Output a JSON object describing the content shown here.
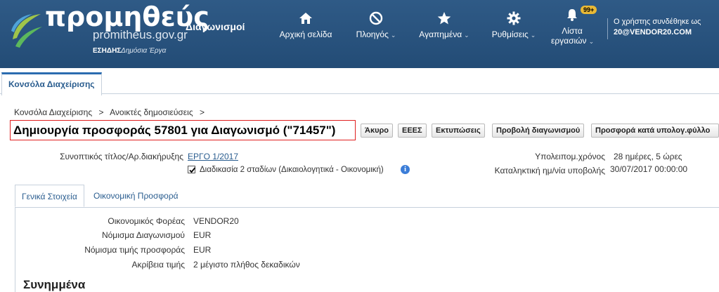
{
  "header": {
    "logo_word": "προμηθεύς",
    "logo_domain": "promitheus.gov.gr",
    "logo_org": "ΕΣΗΔΗΣ",
    "logo_sub": "Δημόσια Έργα",
    "app_name": "Διαγωνισμοί",
    "nav": [
      {
        "label": "Αρχική σελίδα",
        "icon": "home-icon"
      },
      {
        "label": "Πλοηγός",
        "icon": "no-entry-icon"
      },
      {
        "label": "Αγαπημένα",
        "icon": "star-icon"
      },
      {
        "label": "Ρυθμίσεις",
        "icon": "gear-icon"
      },
      {
        "label_line1": "Λίστα",
        "label_line2": "εργασιών",
        "icon": "bell-icon",
        "badge": "99+"
      }
    ],
    "user_prefix": "Ο χρήστης συνδέθηκε ως",
    "user_name": "20@VENDOR20.COM"
  },
  "console_tab": "Κονσόλα Διαχείρισης",
  "breadcrumb": {
    "items": [
      "Κονσόλα Διαχείρισης",
      "Ανοικτές δημοσιεύσεις"
    ],
    "separator": ">"
  },
  "page_title": "Δημιουργία προσφοράς 57801 για Διαγωνισμό (\"71457\")",
  "buttons": {
    "cancel": "Άκυρο",
    "eeeS": "ΕΕΕΣ",
    "prints": "Εκτυπώσεις",
    "view_tender": "Προβολή διαγωνισμού",
    "offer_by_sheet": "Προσφορά κατά υπολογ.φύλλο"
  },
  "summary": {
    "title_label": "Συνοπτικός τίτλος/Αρ.διακήρυξης",
    "title_value": "ΕΡΓΟ 1/2017",
    "two_stage_label": "Διαδικασία 2 σταδίων (Δικαιολογητικά - Οικονομική)",
    "two_stage_checked": true,
    "remaining_label": "Υπολειπομ.χρόνος",
    "remaining_value": "28 ημέρες, 5 ώρες",
    "deadline_label": "Καταληκτική ημ/νία υποβολής",
    "deadline_value": "30/07/2017 00:00:00"
  },
  "subtabs": [
    "Γενικά Στοιχεία",
    "Οικονομική Προσφορά"
  ],
  "general": {
    "rows": [
      {
        "label": "Οικονομικός Φορέας",
        "value": "VENDOR20"
      },
      {
        "label": "Νόμισμα Διαγωνισμού",
        "value": "EUR"
      },
      {
        "label": "Νόμισμα τιμής προσφοράς",
        "value": "EUR"
      },
      {
        "label": "Ακρίβεια τιμής",
        "value": "2 μέγιστο πλήθος δεκαδικών"
      }
    ]
  },
  "section_title": "Συνημμένα",
  "colors": {
    "header": "#2f5a86",
    "accent": "#2b6cb0",
    "link": "#2a5d8f",
    "highlight_border": "#e02020",
    "badge": "#e9b935"
  }
}
